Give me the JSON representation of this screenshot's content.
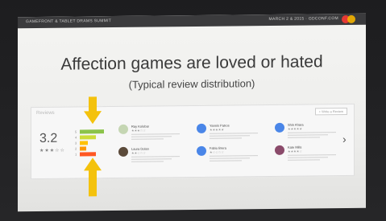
{
  "slide": {
    "header_left": "GAMEFRONT & TABLET DRAMS SUMMIT",
    "header_right": "MARCH 2 & 2015 · GDCONF.COM",
    "title": "Affection games are loved or hated",
    "subtitle": "(Typical review distribution)"
  },
  "review_panel": {
    "label": "Reviews",
    "more_button": "+ Write a Review",
    "rating_value": "3.2",
    "rating_stars": "★★★☆☆",
    "histogram": [
      {
        "star": "5",
        "fraction": 0.75,
        "color": "#8bc34a"
      },
      {
        "star": "4",
        "fraction": 0.5,
        "color": "#cddc39"
      },
      {
        "star": "3",
        "fraction": 0.25,
        "color": "#ffc107"
      },
      {
        "star": "2",
        "fraction": 0.2,
        "color": "#ff9800"
      },
      {
        "star": "1",
        "fraction": 0.5,
        "color": "#ff5722"
      }
    ],
    "reviews": [
      {
        "name": "Ray Kolobar",
        "stars": "★★★☆☆",
        "avatar_color": "#c5d6b3"
      },
      {
        "name": "Yannis Patros",
        "stars": "★★★★★",
        "avatar_color": "#4a86e8"
      },
      {
        "name": "Shin Ahara",
        "stars": "★★★★★",
        "avatar_color": "#4a86e8"
      },
      {
        "name": "Laura Dolan",
        "stars": "★★☆☆☆",
        "avatar_color": "#5b4a3a"
      },
      {
        "name": "Fabio Brera",
        "stars": "★☆☆☆☆",
        "avatar_color": "#4a86e8"
      },
      {
        "name": "Kate Mills",
        "stars": "★★★★☆",
        "avatar_color": "#8a4a6a"
      }
    ]
  },
  "colors": {
    "arrow": "#f4c20d",
    "frame": "#1f1f21"
  }
}
